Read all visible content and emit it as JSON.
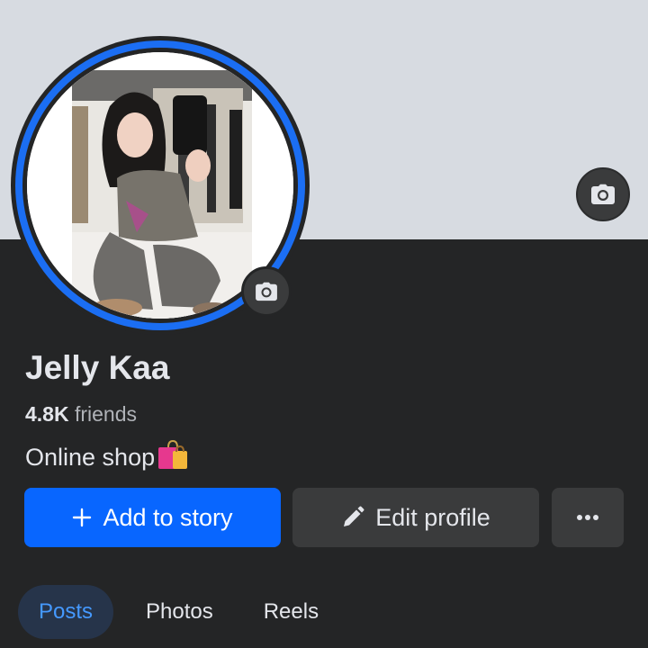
{
  "profile": {
    "name": "Jelly Kaa",
    "friends_count": "4.8K",
    "friends_label": "friends",
    "bio": "Online shop"
  },
  "actions": {
    "add_to_story": "Add to story",
    "edit_profile": "Edit profile"
  },
  "tabs": [
    {
      "label": "Posts",
      "active": true
    },
    {
      "label": "Photos",
      "active": false
    },
    {
      "label": "Reels",
      "active": false
    }
  ],
  "icons": {
    "cover_camera": "camera-icon",
    "avatar_camera": "camera-icon",
    "add": "plus-icon",
    "edit": "pencil-icon",
    "more": "more-icon",
    "bio_emoji": "shopping-bags-icon"
  },
  "colors": {
    "accent": "#0866ff",
    "active_tab_text": "#4599ff",
    "ring": "#1b6ef3"
  }
}
